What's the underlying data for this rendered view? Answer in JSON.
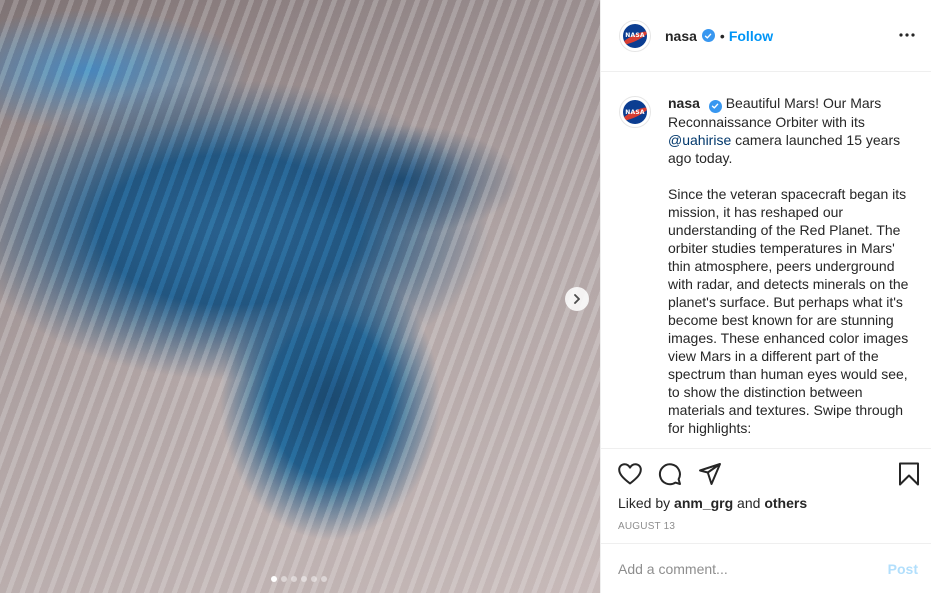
{
  "image": {
    "carousel_total": 6,
    "carousel_active": 1
  },
  "header": {
    "username": "nasa",
    "separator": "•",
    "follow_label": "Follow"
  },
  "caption": {
    "username": "nasa",
    "p1_before": "Beautiful Mars! Our Mars Reconnaissance Orbiter with its ",
    "mention": "@uahirise",
    "p1_after": " camera launched 15 years ago today.",
    "p2": "Since the veteran spacecraft began its mission, it has reshaped our understanding of the Red Planet. The orbiter studies temperatures in Mars' thin atmosphere, peers underground with radar, and detects minerals on the planet's surface. But perhaps what it's become best known for are stunning images. These enhanced color images view Mars in a different part of the spectrum than human eyes would see, to show the distinction between materials and textures. Swipe through for highlights:"
  },
  "actions": {
    "liked_by_prefix": "Liked by ",
    "liked_by_user": "anm_grg",
    "liked_by_mid": " and ",
    "liked_by_others": "others",
    "date": "AUGUST 13"
  },
  "comment": {
    "placeholder": "Add a comment...",
    "post_label": "Post"
  },
  "icons": {
    "like": "heart-icon",
    "comment": "comment-icon",
    "share": "share-icon",
    "save": "bookmark-icon",
    "more": "more-options-icon",
    "next": "chevron-right-icon",
    "verified": "verified-badge-icon"
  },
  "colors": {
    "link": "#0095f6",
    "verified": "#3897f0",
    "post_disabled": "#b2dffc",
    "muted": "#8e8e8e"
  }
}
